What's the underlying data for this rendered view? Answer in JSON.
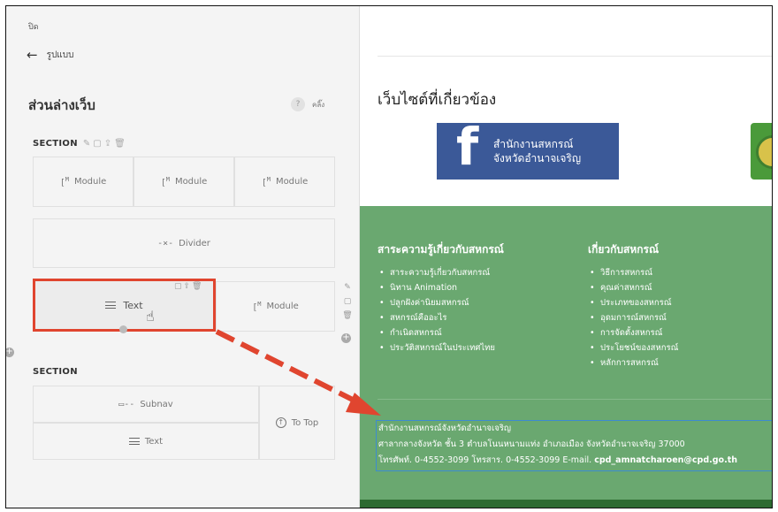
{
  "panel": {
    "close_label": "ปิด",
    "back_label": "รูปแบบ",
    "title": "ส่วนล่างเว็บ",
    "help_symbol": "?",
    "help_text": "คลิ๊ง",
    "section1_label": "SECTION",
    "section2_label": "SECTION",
    "module_label": "Module",
    "divider_label": "Divider",
    "text_label": "Text",
    "subnav_label": "Subnav",
    "to_top_label": "To Top"
  },
  "preview": {
    "related_sites_title": "เว็บไซต์ที่เกี่ยวข้อง",
    "fb_banner_line1": "สำนักงานสหกรณ์",
    "fb_banner_line2": "จังหวัดอำนาจเจริญ",
    "col1": {
      "title": "สาระความรู้เกี่ยวกับสหกรณ์",
      "items": [
        "สาระความรู้เกี่ยวกับสหกรณ์",
        "นิทาน Animation",
        "ปลูกฝังค่านิยมสหกรณ์",
        "สหกรณ์คืออะไร",
        "กำเนิดสหกรณ์",
        "ประวัติสหกรณ์ในประเทศไทย"
      ]
    },
    "col2": {
      "title": "เกี่ยวกับสหกรณ์",
      "items": [
        "วิธีการสหกรณ์",
        "คุณค่าสหกรณ์",
        "ประเภทของสหกรณ์",
        "อุดมการณ์สหกรณ์",
        "การจัดตั้งสหกรณ์",
        "ประโยชน์ของสหกรณ์",
        "หลักการสหกรณ์"
      ]
    },
    "contact_line1": "สำนักงานสหกรณ์จังหวัดอำนาจเจริญ",
    "contact_line2": "ศาลากลางจังหวัด ชั้น 3 ตำบลโนนหนามแท่ง อำเภอเมือง จังหวัดอำนาจเจริญ 37000",
    "contact_line3": "โทรศัพท์. 0-4552-3099 โทรสาร. 0-4552-3099 E-mail. ",
    "contact_email": "cpd_amnatcharoen@cpd.go.th"
  },
  "colors": {
    "highlight": "#e0452f",
    "footer_green": "#6aa870",
    "facebook_blue": "#3b5998"
  }
}
